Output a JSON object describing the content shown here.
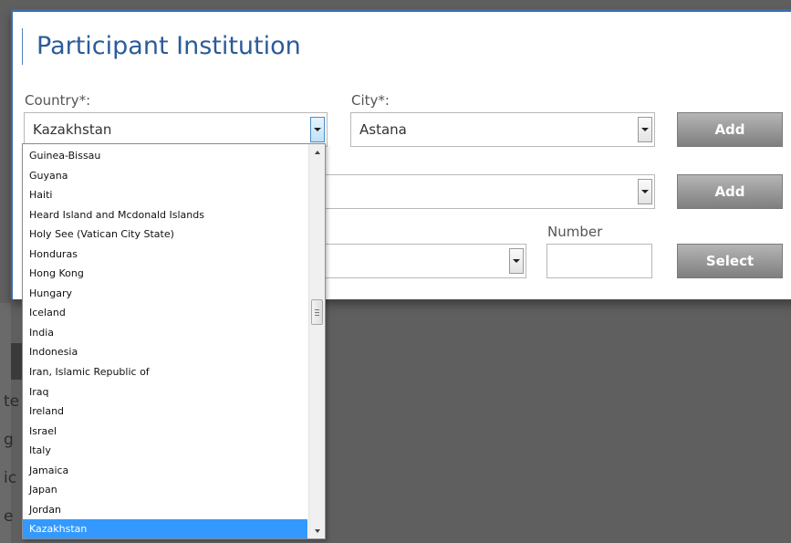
{
  "dialog": {
    "title": "Participant Institution",
    "country": {
      "label": "Country*:",
      "value": "Kazakhstan"
    },
    "city": {
      "label": "City*:",
      "value": "Astana"
    },
    "number": {
      "label": "Number",
      "value": ""
    },
    "buttons": {
      "add_city": "Add",
      "add_second": "Add",
      "select": "Select"
    }
  },
  "country_dropdown": {
    "items": [
      "Guinea-Bissau",
      "Guyana",
      "Haiti",
      "Heard Island and Mcdonald Islands",
      "Holy See (Vatican City State)",
      "Honduras",
      "Hong Kong",
      "Hungary",
      "Iceland",
      "India",
      "Indonesia",
      "Iran, Islamic Republic of",
      "Iraq",
      "Ireland",
      "Israel",
      "Italy",
      "Jamaica",
      "Japan",
      "Jordan",
      "Kazakhstan"
    ],
    "selected": "Kazakhstan"
  },
  "background_fragments": [
    "te",
    "g",
    "ic",
    "e"
  ],
  "colors": {
    "accent": "#2b5b9a",
    "selection": "#3399ff",
    "button": "#8f8f8f"
  }
}
